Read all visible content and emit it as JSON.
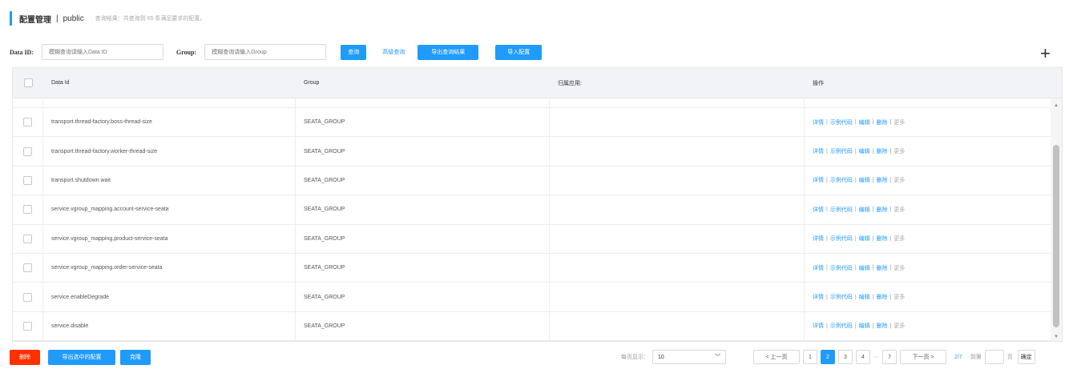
{
  "header": {
    "title": "配置管理",
    "separator": "|",
    "namespace": "public",
    "description": "查询结果：共查询到 65 条满足要求的配置。"
  },
  "search": {
    "data_id_label": "Data ID:",
    "data_id_placeholder": "模糊查询请输入Data ID",
    "group_label": "Group:",
    "group_placeholder": "模糊查询请输入Group",
    "query_button": "查询",
    "advanced_query_link": "高级查询",
    "export_results_button": "导出查询结果",
    "import_config_button": "导入配置"
  },
  "table": {
    "headers": [
      "Data Id",
      "Group",
      "归属应用:",
      "操作"
    ],
    "rows": [
      {
        "data_id": "transport.thread-factory.boss-thread-size",
        "group": "SEATA_GROUP",
        "app": ""
      },
      {
        "data_id": "transport.thread-factory.worker-thread-size",
        "group": "SEATA_GROUP",
        "app": ""
      },
      {
        "data_id": "transport.shutdown.wait",
        "group": "SEATA_GROUP",
        "app": ""
      },
      {
        "data_id": "service.vgroup_mapping.account-service-seata",
        "group": "SEATA_GROUP",
        "app": ""
      },
      {
        "data_id": "service.vgroup_mapping.product-service-seata",
        "group": "SEATA_GROUP",
        "app": ""
      },
      {
        "data_id": "service.vgroup_mapping.order-service-seata",
        "group": "SEATA_GROUP",
        "app": ""
      },
      {
        "data_id": "service.enableDegrade",
        "group": "SEATA_GROUP",
        "app": ""
      },
      {
        "data_id": "service.disable",
        "group": "SEATA_GROUP",
        "app": ""
      }
    ],
    "ops": {
      "detail": "详情",
      "sample_code": "示例代码",
      "edit": "编辑",
      "delete": "删除",
      "more": "更多",
      "sep": "|"
    }
  },
  "bottom": {
    "delete_button": "删除",
    "export_selected_button": "导出选中的配置",
    "clone_button": "克隆"
  },
  "pager": {
    "per_page_label": "每页显示：",
    "per_page_value": "10",
    "prev": "< 上一页",
    "pages": [
      "1",
      "2",
      "3",
      "4"
    ],
    "ellipsis": "···",
    "last_page": "7",
    "next": "下一页 >",
    "page_info": "2/7",
    "goto_label": "到第",
    "page_unit": "页",
    "confirm": "确定",
    "current_page": "2"
  },
  "colors": {
    "primary": "#209bfa",
    "danger": "#ff3000",
    "header_bg": "#f2f3f7"
  }
}
